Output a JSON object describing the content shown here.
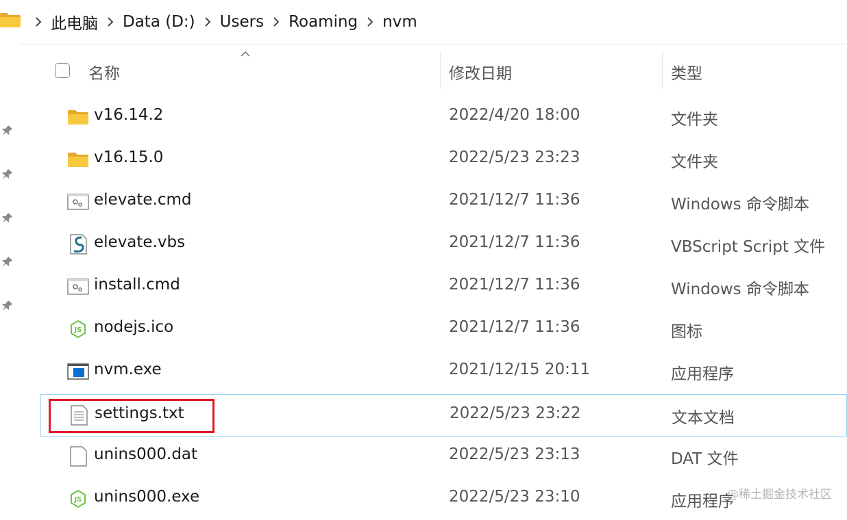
{
  "breadcrumb": {
    "items": [
      "此电脑",
      "Data (D:)",
      "Users",
      "Roaming",
      "nvm"
    ]
  },
  "columns": {
    "name": "名称",
    "date": "修改日期",
    "type": "类型"
  },
  "files": [
    {
      "name": "v16.14.2",
      "date": "2022/4/20 18:00",
      "type": "文件夹",
      "icon": "folder-icon"
    },
    {
      "name": "v16.15.0",
      "date": "2022/5/23 23:23",
      "type": "文件夹",
      "icon": "folder-icon"
    },
    {
      "name": "elevate.cmd",
      "date": "2021/12/7 11:36",
      "type": "Windows 命令脚本",
      "icon": "cmd-script-icon"
    },
    {
      "name": "elevate.vbs",
      "date": "2021/12/7 11:36",
      "type": "VBScript Script 文件",
      "icon": "vbs-script-icon"
    },
    {
      "name": "install.cmd",
      "date": "2021/12/7 11:36",
      "type": "Windows 命令脚本",
      "icon": "cmd-script-icon"
    },
    {
      "name": "nodejs.ico",
      "date": "2021/12/7 11:36",
      "type": "图标",
      "icon": "nodejs-icon"
    },
    {
      "name": "nvm.exe",
      "date": "2021/12/15 20:11",
      "type": "应用程序",
      "icon": "exe-app-icon"
    },
    {
      "name": "settings.txt",
      "date": "2022/5/23 23:22",
      "type": "文本文档",
      "icon": "text-document-icon"
    },
    {
      "name": "unins000.dat",
      "date": "2022/5/23 23:13",
      "type": "DAT 文件",
      "icon": "blank-file-icon"
    },
    {
      "name": "unins000.exe",
      "date": "2022/5/23 23:10",
      "type": "应用程序",
      "icon": "nodejs-icon"
    }
  ],
  "watermark": "@稀土掘金技术社区",
  "colors": {
    "folder": "#f8c93e",
    "selection_border": "#99d1ef",
    "highlight_box": "#e11b2b",
    "nodejs_green": "#6cc24a"
  }
}
